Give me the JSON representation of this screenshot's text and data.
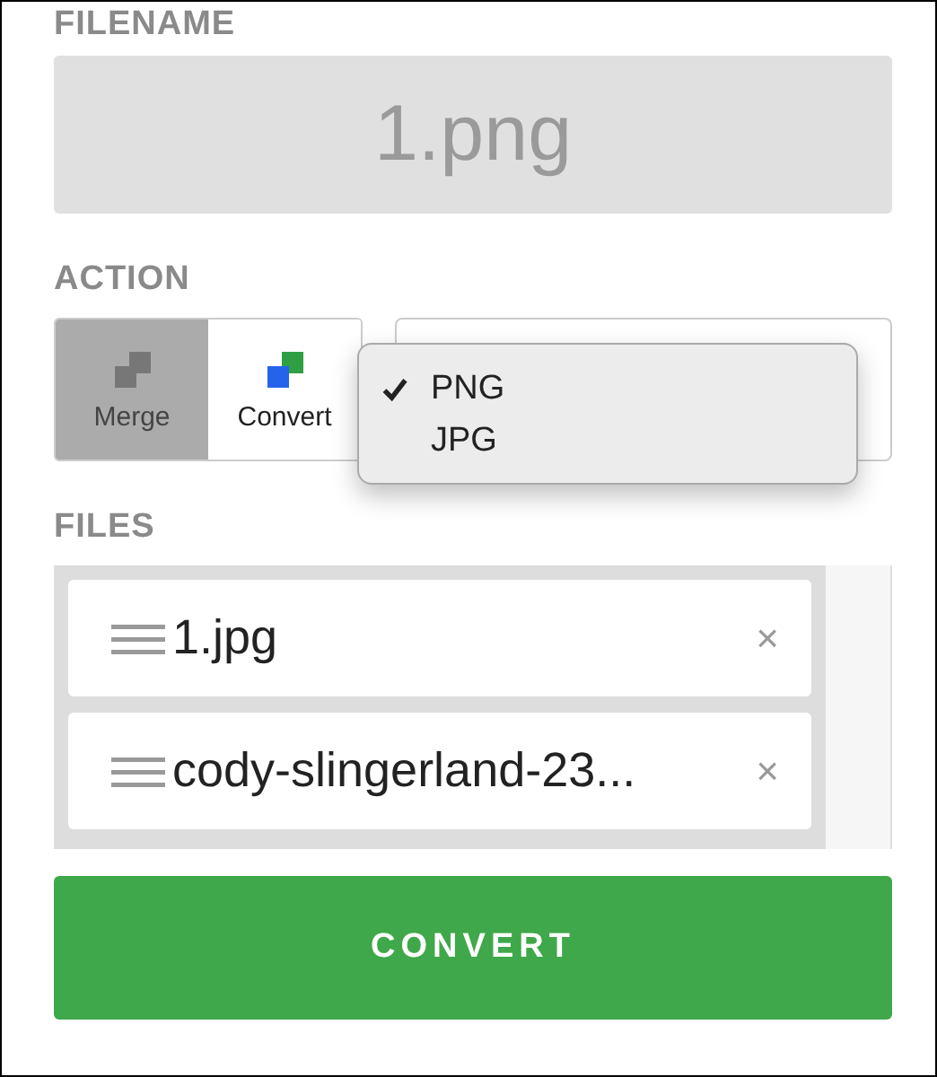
{
  "filename": {
    "label": "FILENAME",
    "value": "1.png"
  },
  "action": {
    "label": "ACTION",
    "options": [
      {
        "label": "Merge",
        "kind": "merge",
        "selected": false
      },
      {
        "label": "Convert",
        "kind": "convert",
        "selected": true
      }
    ],
    "format_menu": [
      {
        "label": "PNG",
        "checked": true
      },
      {
        "label": "JPG",
        "checked": false
      }
    ]
  },
  "files": {
    "label": "FILES",
    "items": [
      {
        "name": "1.jpg",
        "remove": "×"
      },
      {
        "name": "cody-slingerland-23...",
        "remove": "×"
      }
    ]
  },
  "submit": "CONVERT"
}
